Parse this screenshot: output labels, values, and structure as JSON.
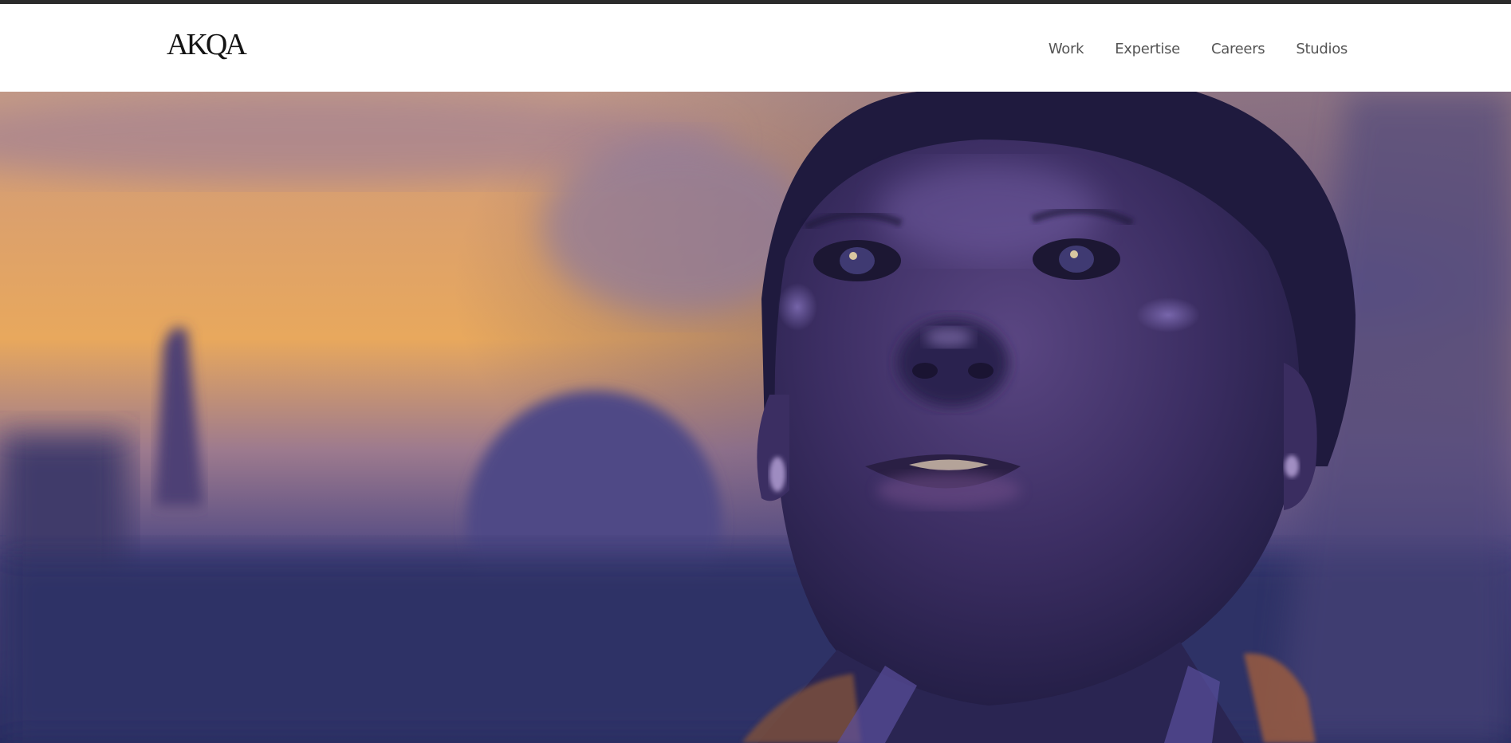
{
  "header": {
    "logo_text": "AKQA",
    "nav": [
      {
        "label": "Work"
      },
      {
        "label": "Expertise"
      },
      {
        "label": "Careers"
      },
      {
        "label": "Studios"
      }
    ]
  },
  "hero": {
    "image": "hero-portrait-photo",
    "colors": {
      "sky_warm": "#e7a75e",
      "sky_purple": "#8a6f9e",
      "scene_blue": "#2e2f66",
      "face_purple": "#3d2f63"
    }
  }
}
